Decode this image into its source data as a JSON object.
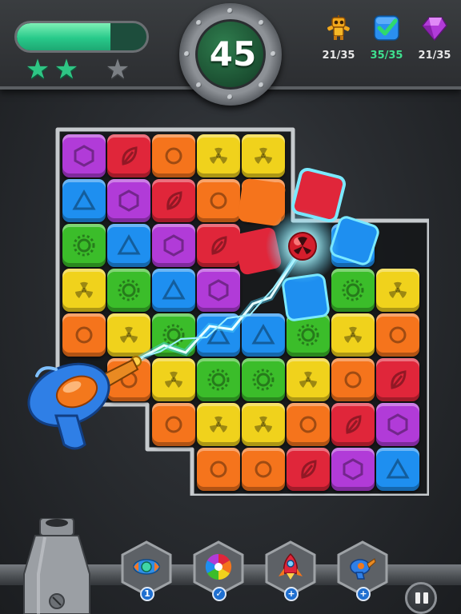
{
  "hud": {
    "progress_fraction": 0.72,
    "stars": [
      {
        "state": "earned"
      },
      {
        "state": "earned"
      },
      {
        "state": "not-earned"
      }
    ],
    "moves_left": "45",
    "goals": [
      {
        "name": "robot-toy-icon",
        "count": "21/35",
        "complete": false
      },
      {
        "name": "checked-blue-cube-icon",
        "count": "35/35",
        "complete": true
      },
      {
        "name": "purple-gem-icon",
        "count": "21/35",
        "complete": false
      }
    ]
  },
  "colors": {
    "purple": "#b13bd8",
    "red": "#e0263a",
    "orange": "#f5741c",
    "yellow": "#f0d21c",
    "blue": "#1e8ff0",
    "green": "#3bbd2a"
  },
  "board": {
    "rows": [
      [
        "purple-hexagon",
        "red-leaf",
        "orange-circle",
        "yellow-radiation",
        "yellow-radiation",
        null,
        null,
        null
      ],
      [
        "blue-triangle",
        "purple-hexagon",
        "red-leaf",
        "orange-circle",
        "orange-circle",
        null,
        null,
        null
      ],
      [
        "green-gear",
        "blue-triangle",
        "purple-hexagon",
        "red-leaf",
        null,
        null,
        "blue-triangle",
        null
      ],
      [
        "yellow-radiation",
        "green-gear",
        "blue-triangle",
        "purple-hexagon",
        null,
        null,
        "green-gear",
        "yellow-radiation"
      ],
      [
        "orange-circle",
        "yellow-radiation",
        "green-gear",
        "blue-triangle",
        "blue-triangle",
        "green-gear",
        "yellow-radiation",
        "orange-circle"
      ],
      [
        null,
        "orange-circle",
        "yellow-radiation",
        "green-gear",
        "green-gear",
        "yellow-radiation",
        "orange-circle",
        "red-leaf"
      ],
      [
        null,
        null,
        "orange-circle",
        "yellow-radiation",
        "yellow-radiation",
        "orange-circle",
        "red-leaf",
        "purple-hexagon"
      ],
      [
        null,
        null,
        null,
        "orange-circle",
        "orange-circle",
        "red-leaf",
        "purple-hexagon",
        "blue-triangle"
      ]
    ],
    "flying_tiles": [
      "red-leaf",
      "red-leaf",
      "blue-triangle",
      "blue-triangle"
    ],
    "active_booster": "ray-gun"
  },
  "dock": {
    "boosters": [
      {
        "name": "rocket-booster-icon",
        "badge": "1"
      },
      {
        "name": "color-wheel-booster-icon",
        "badge": "✓"
      },
      {
        "name": "red-rocket-booster-icon",
        "badge": "+"
      },
      {
        "name": "ray-gun-booster-icon",
        "badge": "+"
      }
    ]
  }
}
